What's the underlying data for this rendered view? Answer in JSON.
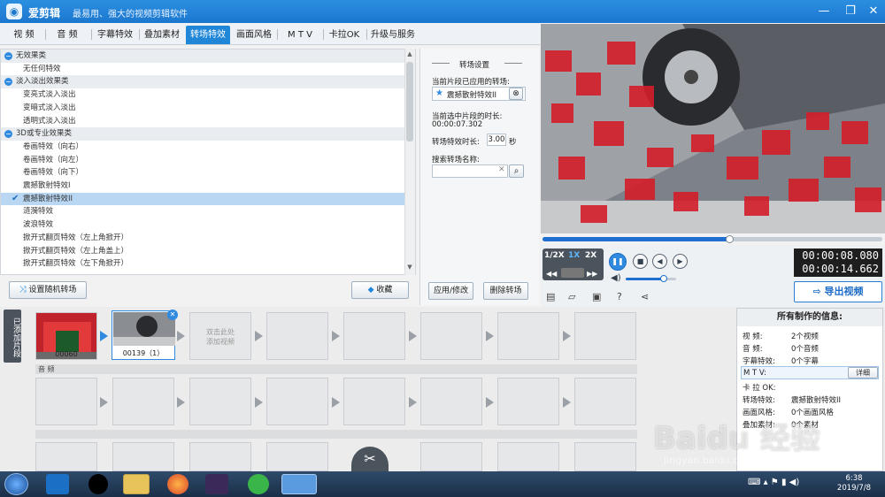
{
  "app": {
    "title": "爱剪辑",
    "slogan": "最易用、强大的视频剪辑软件",
    "logo_glyph": "◉"
  },
  "window_controls": {
    "minimize": "—",
    "maximize": "❐",
    "close": "✕"
  },
  "tabs": [
    "视 频",
    "音 频",
    "字幕特效",
    "叠加素材",
    "转场特效",
    "画面风格",
    "M T V",
    "卡拉OK",
    "升级与服务"
  ],
  "active_tab": "转场特效",
  "effect_list": [
    {
      "type": "cat",
      "label": "无效果类"
    },
    {
      "type": "item",
      "label": "无任何特效"
    },
    {
      "type": "cat",
      "label": "淡入淡出效果类"
    },
    {
      "type": "item",
      "label": "变亮式淡入淡出"
    },
    {
      "type": "item",
      "label": "变暗式淡入淡出"
    },
    {
      "type": "item",
      "label": "透明式淡入淡出"
    },
    {
      "type": "cat",
      "label": "3D或专业效果类"
    },
    {
      "type": "item",
      "label": "卷画特效（向右）"
    },
    {
      "type": "item",
      "label": "卷画特效（向左）"
    },
    {
      "type": "item",
      "label": "卷画特效（向下）"
    },
    {
      "type": "item",
      "label": "震撼散射特效I"
    },
    {
      "type": "item",
      "label": "震撼散射特效II",
      "selected": true
    },
    {
      "type": "item",
      "label": "涟漪特效"
    },
    {
      "type": "item",
      "label": "波浪特效"
    },
    {
      "type": "item",
      "label": "掀开式翻页特效（左上角掀开）"
    },
    {
      "type": "item",
      "label": "掀开式翻页特效（左上角盖上）"
    },
    {
      "type": "item",
      "label": "掀开式翻页特效（左下角掀开）"
    }
  ],
  "list_buttons": {
    "random": "设置随机转场",
    "favorite": "收藏"
  },
  "settings": {
    "title": "转场设置",
    "applied_label": "当前片段已应用的转场:",
    "applied_value": "震撼散射特效II",
    "duration_label": "当前选中片段的时长:",
    "duration_value": "00:00:07.302",
    "effect_duration_label": "转场特效时长:",
    "effect_duration_value": "3.00",
    "unit": "秒",
    "search_label": "搜索转场名称:",
    "search_value": "",
    "apply_button": "应用/修改",
    "delete_button": "删除转场"
  },
  "player": {
    "progress": 0.55,
    "speeds": [
      "1/2X",
      "1X",
      "2X"
    ],
    "time_current": "00:00:08.080",
    "time_total": "00:00:14.662",
    "volume": 0.75,
    "export_label": "导出视频"
  },
  "timeline": {
    "side_tab": "已添加片段",
    "clips": [
      {
        "label": "00060"
      },
      {
        "label": "00139（1）"
      }
    ],
    "add_hint": "双击此处\n添加视频",
    "audio_label": "音 频"
  },
  "info": {
    "title": "所有制作的信息:",
    "rows": [
      {
        "k": "视    频:",
        "v": "2个视频"
      },
      {
        "k": "音    频:",
        "v": "0个音频"
      },
      {
        "k": "字幕特效:",
        "v": "0个字幕"
      },
      {
        "k": "M  T  V:",
        "v": ""
      },
      {
        "k": "卡  拉  OK:",
        "v": ""
      },
      {
        "k": "转场特效:",
        "v": "震撼散射特效II"
      },
      {
        "k": "画面风格:",
        "v": "0个画面风格"
      },
      {
        "k": "叠加素材:",
        "v": "0个素材"
      }
    ],
    "detail_button": "详细"
  },
  "taskbar": {
    "time": "6:38",
    "date": "2019/7/8"
  },
  "watermark": {
    "text": "Baidu 经验",
    "sub": "jingyan.baidu.com"
  }
}
